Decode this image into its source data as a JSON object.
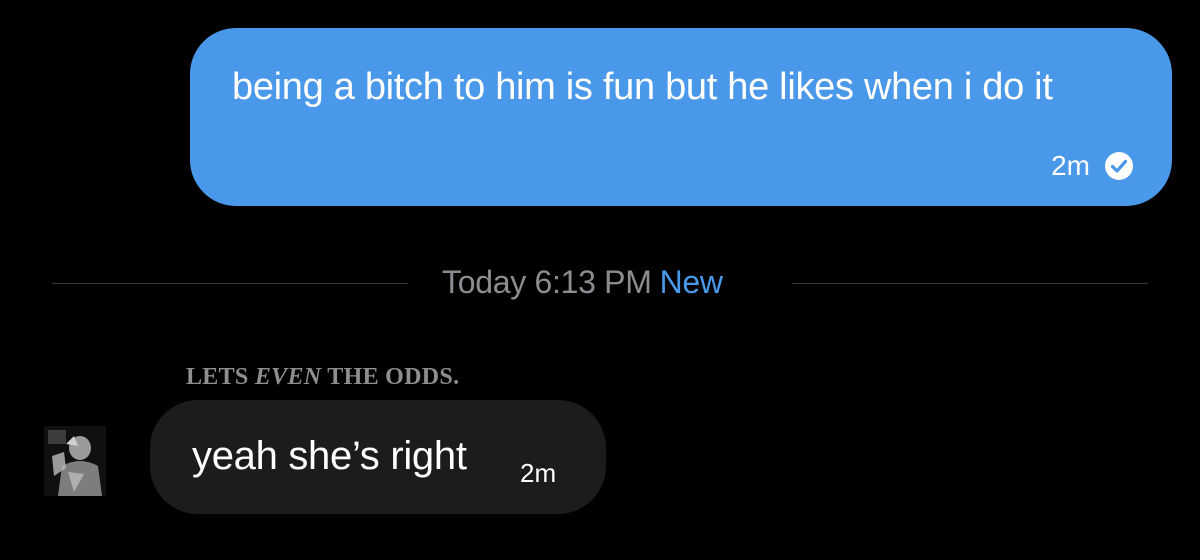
{
  "outgoing_message": {
    "text": "being a bitch to him is fun but he likes when i do it",
    "time": "2m",
    "status_icon": "check-circle-icon"
  },
  "divider": {
    "timestamp": "Today 6:13 PM",
    "new_label": "New"
  },
  "incoming_message": {
    "sender_name_part1": "LETS ",
    "sender_name_part2": "EVEN",
    "sender_name_part3": " THE ODDS.",
    "text": "yeah she’s right",
    "time": "2m",
    "avatar_icon": "avatar-image"
  },
  "colors": {
    "outgoing_bubble": "#4a98e9",
    "incoming_bubble": "#1c1c1e",
    "new_accent": "#4a98e9",
    "muted_text": "#8b8d91",
    "background": "#000000"
  }
}
